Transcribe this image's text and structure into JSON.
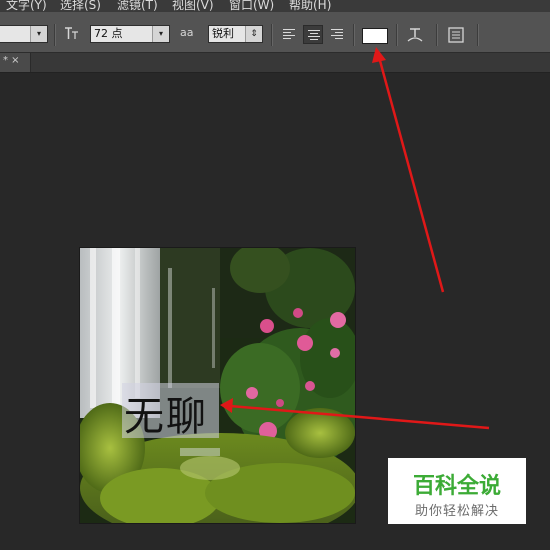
{
  "menu": {
    "items": [
      "文字(Y)",
      "选择(S)",
      "滤镜(T)",
      "视图(V)",
      "窗口(W)",
      "帮助(H)"
    ]
  },
  "options_bar": {
    "font_size": "72 点",
    "antialias": "锐利",
    "antialias_icon": "aa",
    "text_color": "#ffffff"
  },
  "document_tab": {
    "label": "* ×"
  },
  "canvas": {
    "text_content": "无聊"
  },
  "watermark": {
    "title": "百科全说",
    "subtitle": "助你轻松解决"
  },
  "colors": {
    "annotation_arrow": "#e01818",
    "watermark_green": "#3cab36"
  }
}
